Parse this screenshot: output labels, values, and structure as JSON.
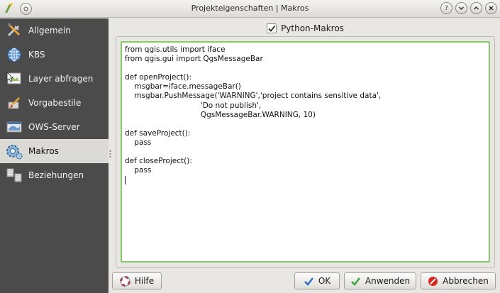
{
  "window": {
    "title": "Projekteigenschaften | Makros"
  },
  "sidebar": {
    "items": [
      {
        "label": "Allgemein",
        "icon": "tools-icon"
      },
      {
        "label": "KBS",
        "icon": "globe-icon"
      },
      {
        "label": "Layer abfragen",
        "icon": "identify-icon"
      },
      {
        "label": "Vorgabestile",
        "icon": "paint-brush-icon"
      },
      {
        "label": "OWS-Server",
        "icon": "ows-server-icon"
      },
      {
        "label": "Makros",
        "icon": "gears-icon"
      },
      {
        "label": "Beziehungen",
        "icon": "relations-icon"
      }
    ],
    "active_index": 5
  },
  "macros": {
    "checkbox_label": "Python-Makros",
    "checked": true,
    "code": "from qgis.utils import iface\nfrom qgis.gui import QgsMessageBar\n\ndef openProject():\n    msgbar=iface.messageBar()\n    msgbar.PushMessage('WARNING','project contains sensitive data',\n                                'Do not publish',\n                                QgsMessageBar.WARNING, 10)\n\ndef saveProject():\n    pass\n\ndef closeProject():\n    pass\n"
  },
  "buttons": {
    "help": "Hilfe",
    "ok": "OK",
    "apply": "Anwenden",
    "cancel": "Abbrechen"
  },
  "colors": {
    "sidebar_bg": "#4b4b4b",
    "editor_focus_border": "#86c96a",
    "cancel_red": "#d9261c",
    "ok_blue": "#2f6fc0",
    "apply_green": "#3aa63a"
  }
}
